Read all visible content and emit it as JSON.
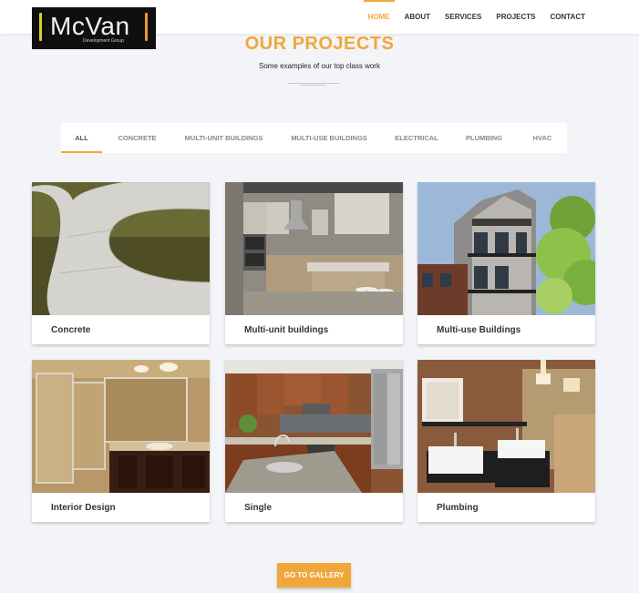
{
  "header": {
    "logo_text": "McVan",
    "logo_sub": "Development Group",
    "nav": [
      "HOME",
      "ABOUT",
      "SERVICES",
      "PROJECTS",
      "CONTACT"
    ],
    "active_nav": "HOME"
  },
  "section": {
    "title": "OUR PROJECTS",
    "subtitle": "Some examples of our top class work"
  },
  "filters": {
    "tabs": [
      "ALL",
      "CONCRETE",
      "MULTI-UNIT BUILDINGS",
      "MULTI-USE BUILDINGS",
      "ELECTRICAL",
      "PLUMBING",
      "HVAC"
    ],
    "active": "ALL"
  },
  "projects": [
    {
      "label": "Concrete",
      "image": "concrete-walkway-photo"
    },
    {
      "label": "Multi-unit buildings",
      "image": "modern-kitchen-photo"
    },
    {
      "label": "Multi-use Buildings",
      "image": "apartment-building-photo"
    },
    {
      "label": "Interior Design",
      "image": "bathroom-vanity-photo"
    },
    {
      "label": "Single",
      "image": "wood-kitchen-photo"
    },
    {
      "label": "Plumbing",
      "image": "modern-bathroom-photo"
    }
  ],
  "cta": {
    "label": "GO TO GALLERY"
  },
  "colors": {
    "accent": "#f0a73a",
    "background": "#f3f4f7"
  }
}
